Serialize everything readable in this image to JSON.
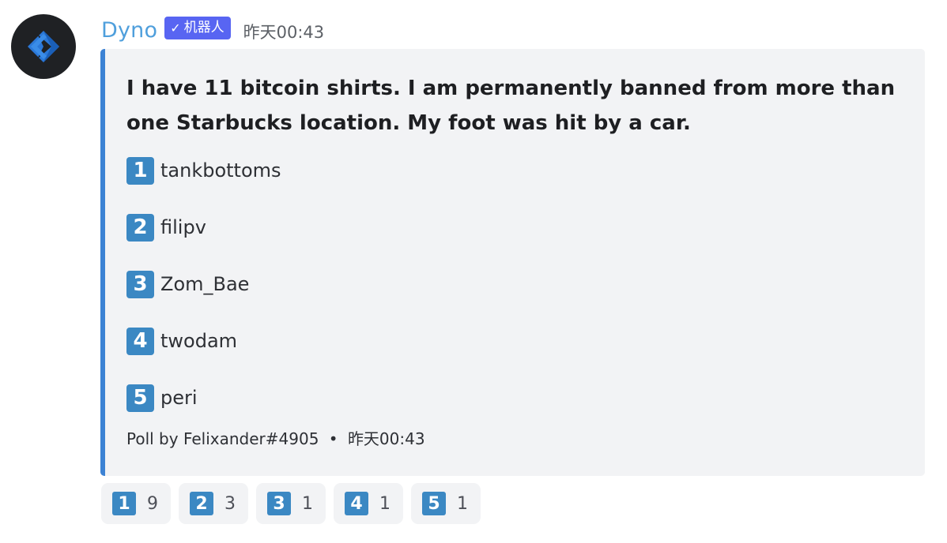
{
  "author": {
    "name": "Dyno",
    "bot_tag": "机器人",
    "timestamp": "昨天00:43",
    "avatar_icon": "dyno-logo-icon"
  },
  "embed": {
    "accent_color": "#3c82d4",
    "description": "I have 11 bitcoin shirts. I am permanently banned from more than one Starbucks location. My foot was hit by a car.",
    "options": [
      {
        "keycap": "1",
        "label": "tankbottoms"
      },
      {
        "keycap": "2",
        "label": "filipv"
      },
      {
        "keycap": "3",
        "label": "Zom_Bae"
      },
      {
        "keycap": "4",
        "label": "twodam"
      },
      {
        "keycap": "5",
        "label": "peri"
      }
    ],
    "footer": {
      "text": "Poll by Felixander#4905",
      "separator": "•",
      "timestamp": "昨天00:43"
    }
  },
  "reactions": [
    {
      "emoji": "1",
      "count": "9"
    },
    {
      "emoji": "2",
      "count": "3"
    },
    {
      "emoji": "3",
      "count": "1"
    },
    {
      "emoji": "4",
      "count": "1"
    },
    {
      "emoji": "5",
      "count": "1"
    }
  ],
  "colors": {
    "username": "#4f9fdc",
    "bot_tag": "#5865f2",
    "keycap": "#3b88c3",
    "embed_bg": "#f2f3f5"
  }
}
